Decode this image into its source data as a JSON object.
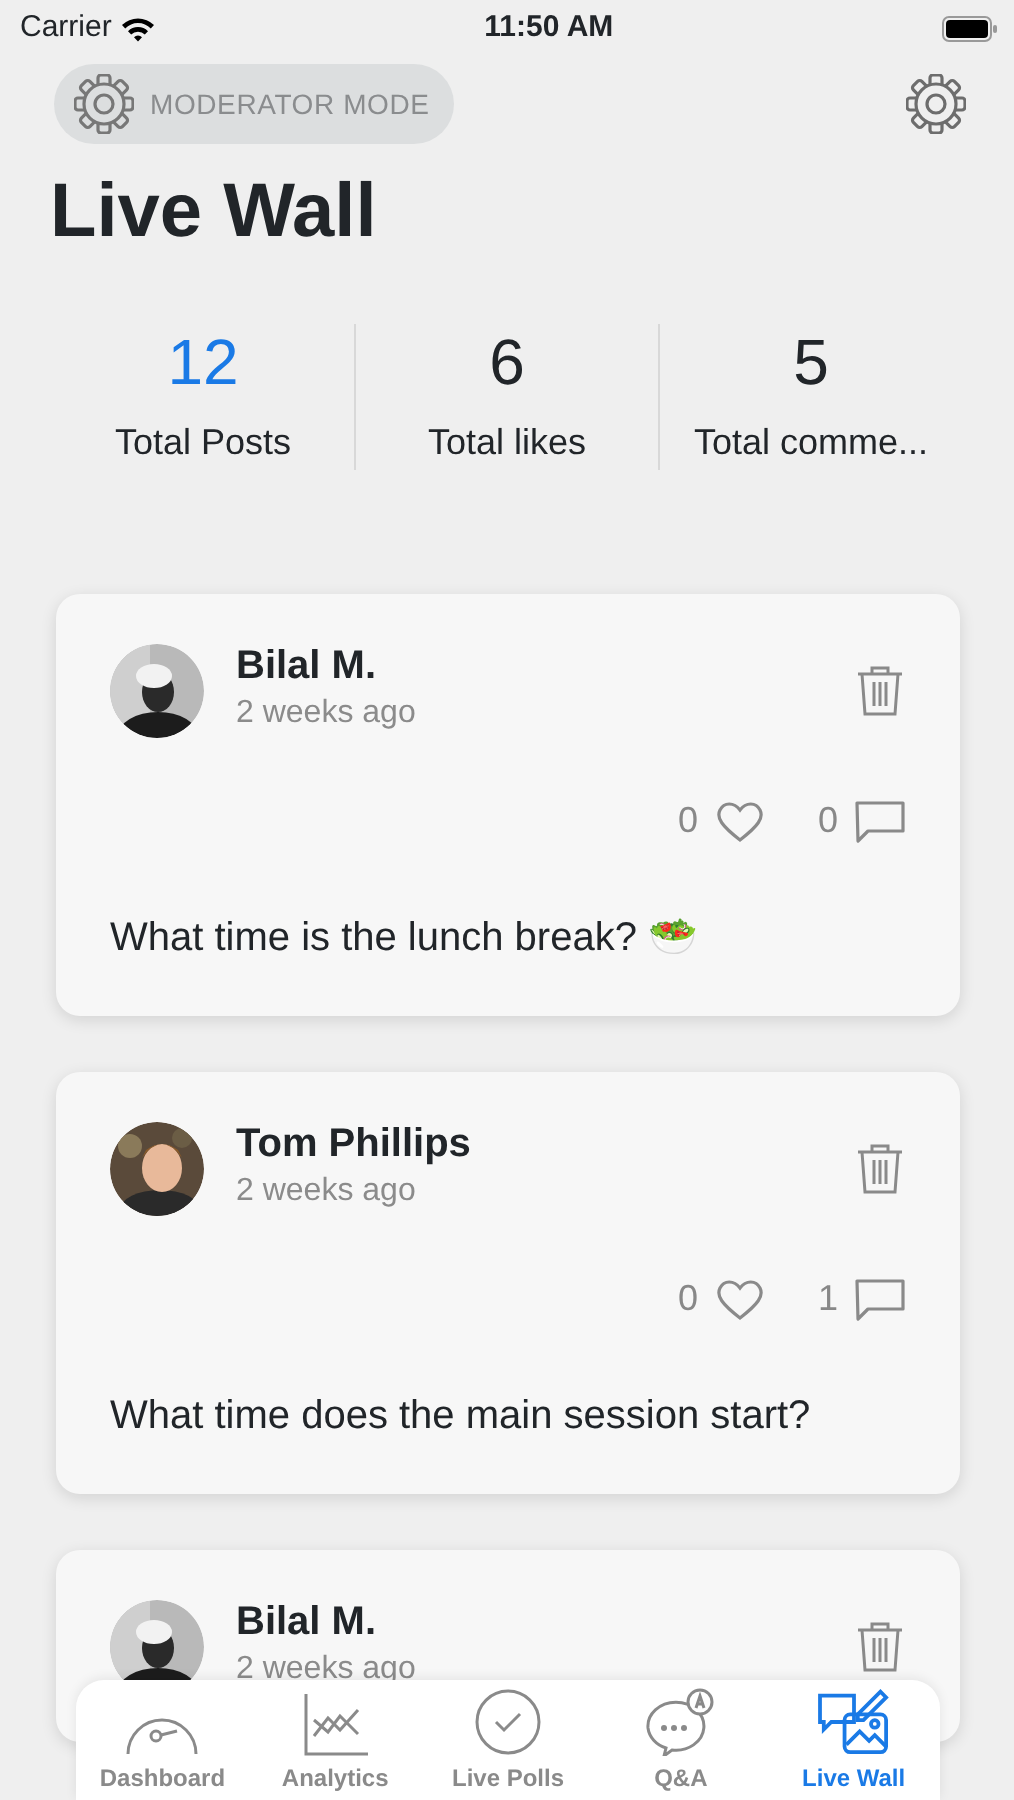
{
  "status_bar": {
    "carrier": "Carrier",
    "time": "11:50 AM"
  },
  "header": {
    "moderator_label": "MODERATOR MODE",
    "title": "Live Wall"
  },
  "stats": [
    {
      "value": "12",
      "label": "Total Posts",
      "selected": true
    },
    {
      "value": "6",
      "label": "Total likes",
      "selected": false
    },
    {
      "value": "5",
      "label": "Total comme...",
      "selected": false
    }
  ],
  "posts": [
    {
      "author": "Bilal M.",
      "time": "2 weeks ago",
      "likes": "0",
      "comments": "0",
      "text": "What time is the lunch break? 🥗"
    },
    {
      "author": "Tom Phillips",
      "time": "2 weeks ago",
      "likes": "0",
      "comments": "1",
      "text": "What time does the main session start?"
    },
    {
      "author": "Bilal M.",
      "time": "2 weeks ago"
    }
  ],
  "tab_bar": [
    {
      "label": "Dashboard",
      "kind": "dashboard",
      "selected": false
    },
    {
      "label": "Analytics",
      "kind": "analytics",
      "selected": false
    },
    {
      "label": "Live Polls",
      "kind": "polls",
      "selected": false
    },
    {
      "label": "Q&A",
      "kind": "qa",
      "selected": false
    },
    {
      "label": "Live Wall",
      "kind": "wall",
      "selected": true
    }
  ]
}
